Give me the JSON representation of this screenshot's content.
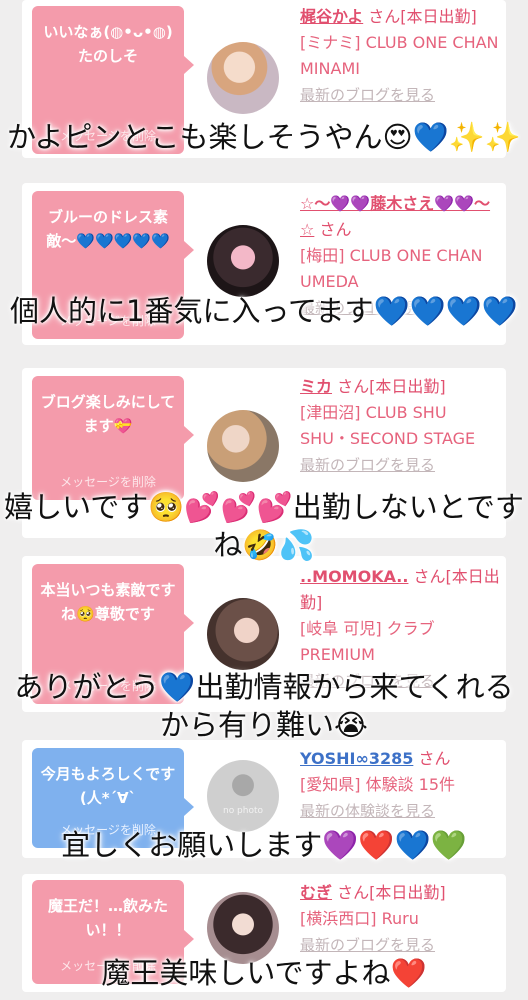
{
  "cards": [
    {
      "bubble_text": "いいなぁ(◍•ᴗ•◍)たのしそ",
      "delete_label": "メッセージを削除",
      "name": "梶谷かよ",
      "suffix": "さん[本日出勤]",
      "shop": "[ミナミ] CLUB ONE CHAN MINAMI",
      "link": "最新のブログを見る",
      "bubble_color": "#f49bab"
    },
    {
      "bubble_text": "ブルーのドレス素敵〜💙💙💙💙💙",
      "delete_label": "メッセージを削除",
      "name": "☆〜💜💜藤木さえ💜💜〜☆",
      "suffix": "さん",
      "shop": "[梅田] CLUB ONE CHAN UMEDA",
      "link": "最新のブログを見る",
      "bubble_color": "#f49bab"
    },
    {
      "bubble_text": "ブログ楽しみにしてます💝",
      "delete_label": "メッセージを削除",
      "name": "ミカ",
      "suffix": "さん[本日出勤]",
      "shop": "[津田沼] CLUB SHU SHU・SECOND STAGE",
      "link": "最新のブログを見る",
      "bubble_color": "#f49bab"
    },
    {
      "bubble_text": "本当いつも素敵ですね🥺尊敬です",
      "delete_label": "メッセージを削除",
      "name": "..MOMOKA..",
      "suffix": "さん[本日出勤]",
      "shop": "[岐阜 可児] クラブPREMIUM",
      "link": "最新のブログを見る",
      "bubble_color": "#f49bab"
    },
    {
      "bubble_text": "今月もよろしくです(人*´∀`",
      "delete_label": "メッセージを削除",
      "name": "YOSHI∞3285",
      "suffix": "さん",
      "shop": "[愛知県] 体験談 15件",
      "link": "最新の体験談を見る",
      "avatar_text": "no photo",
      "bubble_color": "#7fb1ee"
    },
    {
      "bubble_text": "魔王だ！…飲みたい！！",
      "delete_label": "メッセージを削除",
      "name": "むぎ",
      "suffix": "さん[本日出勤]",
      "shop": "[横浜西口] Ruru",
      "link": "最新のブログを見る",
      "bubble_color": "#f49bab"
    }
  ],
  "captions": [
    "かよピンとこも楽しそうやん😍💙✨✨",
    "個人的に1番気に入ってます💙💙💙💙",
    "嬉しいです🥺💕💕💕出勤しないとですね🤣💦",
    "ありがとう💙出勤情報から来てくれるから有り難い😭",
    "宜しくお願いします💜❤️💙💚",
    "魔王美味しいですよね❤️"
  ]
}
